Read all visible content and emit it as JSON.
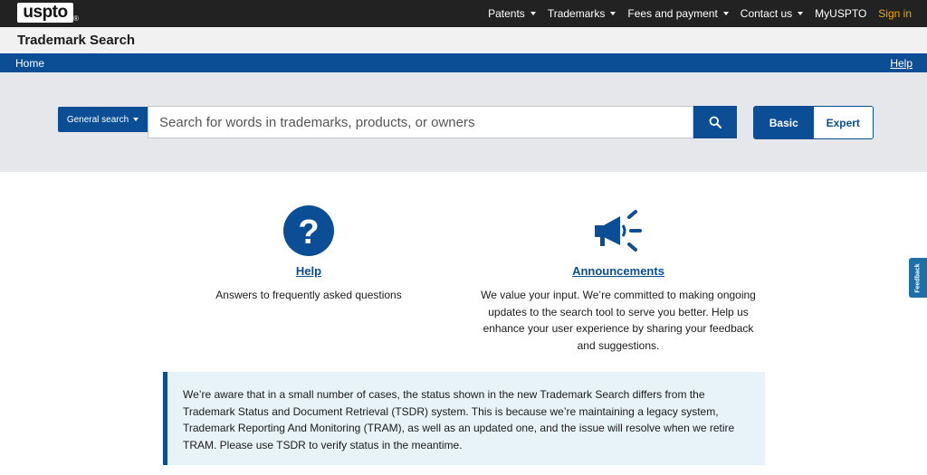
{
  "header": {
    "logo_text": "uspto",
    "logo_mark": "®",
    "nav": [
      {
        "label": "Patents",
        "dropdown": true
      },
      {
        "label": "Trademarks",
        "dropdown": true
      },
      {
        "label": "Fees and payment",
        "dropdown": true
      },
      {
        "label": "Contact us",
        "dropdown": true
      },
      {
        "label": "MyUSPTO",
        "dropdown": false
      }
    ],
    "signin_label": "Sign in"
  },
  "title_bar": {
    "title": "Trademark Search"
  },
  "nav_bar": {
    "home_label": "Home",
    "help_label": "Help"
  },
  "search": {
    "type_label": "General search",
    "placeholder": "Search for words in trademarks, products, or owners",
    "value": "",
    "button_icon": "search-icon",
    "modes": [
      {
        "label": "Basic",
        "selected": true
      },
      {
        "label": "Expert",
        "selected": false
      }
    ]
  },
  "cards": {
    "help": {
      "icon": "question-circle-icon",
      "title": "Help",
      "description": "Answers to frequently asked questions"
    },
    "announcements": {
      "icon": "megaphone-icon",
      "title": "Announcements",
      "description": "We value your input. We’re committed to making ongoing updates to the search tool to serve you better. Help us enhance your user experience by sharing your feedback and suggestions."
    }
  },
  "alert": {
    "text": "We’re aware that in a small number of cases, the status shown in the new Trademark Search differs from the Trademark Status and Document Retrieval (TSDR) system. This is because we’re maintaining a legacy system, Trademark Reporting And Monitoring (TRAM), as well as an updated one, and the issue will resolve when we retire TRAM. Please use TSDR to verify status in the meantime."
  },
  "feedback": {
    "label": "Feedback"
  },
  "colors": {
    "brand_blue": "#0b4e95",
    "topbar": "#222222",
    "signin": "#f0a500",
    "alert_bg": "#e7f3f7"
  }
}
